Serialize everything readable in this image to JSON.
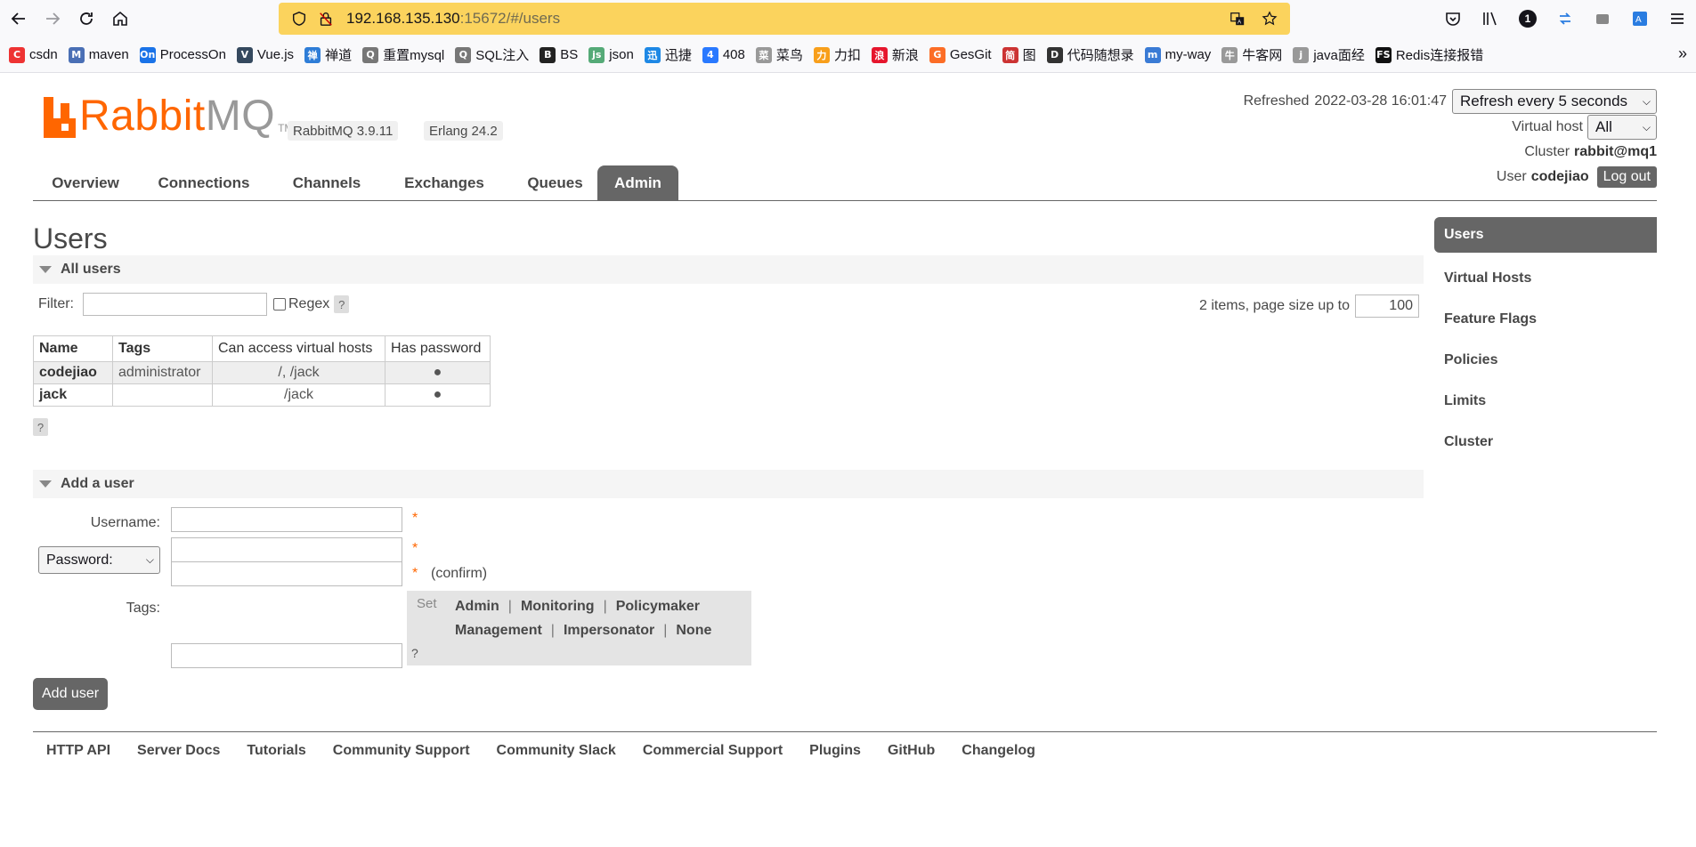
{
  "browser": {
    "url_host": "192.168.135.130",
    "url_rest": ":15672/#/users",
    "bookmarks": [
      {
        "label": "csdn",
        "icon": "C",
        "color": "#e33"
      },
      {
        "label": "maven",
        "icon": "M",
        "color": "#4a6fb5"
      },
      {
        "label": "ProcessOn",
        "icon": "On",
        "color": "#1a73e8"
      },
      {
        "label": "Vue.js",
        "icon": "V",
        "color": "#35495e"
      },
      {
        "label": "禅道",
        "icon": "禅",
        "color": "#2e7dd7"
      },
      {
        "label": "重置mysql",
        "icon": "Q",
        "color": "#777"
      },
      {
        "label": "SQL注入",
        "icon": "Q",
        "color": "#777"
      },
      {
        "label": "BS",
        "icon": "B",
        "color": "#222"
      },
      {
        "label": "json",
        "icon": "js",
        "color": "#5a7"
      },
      {
        "label": "迅捷",
        "icon": "迅",
        "color": "#1e88e5"
      },
      {
        "label": "408",
        "icon": "4",
        "color": "#2979ff"
      },
      {
        "label": "菜鸟",
        "icon": "菜",
        "color": "#999"
      },
      {
        "label": "力扣",
        "icon": "力",
        "color": "#f89f1b"
      },
      {
        "label": "新浪",
        "icon": "浪",
        "color": "#e6162d"
      },
      {
        "label": "GesGit",
        "icon": "G",
        "color": "#fc6d26"
      },
      {
        "label": "图",
        "icon": "简",
        "color": "#c33"
      },
      {
        "label": "代码随想录",
        "icon": "D",
        "color": "#333"
      },
      {
        "label": "my-way",
        "icon": "m",
        "color": "#3a7bd5"
      },
      {
        "label": "牛客网",
        "icon": "牛",
        "color": "#999"
      },
      {
        "label": "java面经",
        "icon": "j",
        "color": "#999"
      },
      {
        "label": "Redis连接报错",
        "icon": "FS",
        "color": "#111"
      }
    ]
  },
  "header": {
    "logo_rabbit": "Rabbit",
    "logo_mq": "MQ",
    "logo_tm": "TM",
    "version": "RabbitMQ 3.9.11",
    "erlang": "Erlang 24.2",
    "refreshed_label": "Refreshed",
    "refreshed_time": "2022-03-28 16:01:47",
    "refresh_select": "Refresh every 5 seconds",
    "vhost_label": "Virtual host",
    "vhost_value": "All",
    "cluster_label": "Cluster",
    "cluster_value": "rabbit@mq1",
    "user_label": "User",
    "user_value": "codejiao",
    "logout": "Log out"
  },
  "tabs": [
    "Overview",
    "Connections",
    "Channels",
    "Exchanges",
    "Queues",
    "Admin"
  ],
  "page": {
    "title": "Users",
    "all_users": "All users",
    "filter_label": "Filter:",
    "regex_label": "Regex",
    "help": "?",
    "pager_text": "2 items, page size up to",
    "page_size": "100",
    "columns": [
      "Name",
      "Tags",
      "Can access virtual hosts",
      "Has password"
    ],
    "rows": [
      {
        "name": "codejiao",
        "tags": "administrator",
        "vhosts": "/, /jack",
        "password": "●"
      },
      {
        "name": "jack",
        "tags": "",
        "vhosts": "/jack",
        "password": "●"
      }
    ]
  },
  "add_user": {
    "heading": "Add a user",
    "username_label": "Username:",
    "password_select": "Password:",
    "required": "*",
    "confirm": "(confirm)",
    "tags_label": "Tags:",
    "set_label": "Set",
    "tags_row1": [
      "Admin",
      "Monitoring",
      "Policymaker"
    ],
    "tags_row2": [
      "Management",
      "Impersonator",
      "None"
    ],
    "sep": "|",
    "button": "Add user"
  },
  "sidebar": [
    "Users",
    "Virtual Hosts",
    "Feature Flags",
    "Policies",
    "Limits",
    "Cluster"
  ],
  "footer": [
    "HTTP API",
    "Server Docs",
    "Tutorials",
    "Community Support",
    "Community Slack",
    "Commercial Support",
    "Plugins",
    "GitHub",
    "Changelog"
  ]
}
